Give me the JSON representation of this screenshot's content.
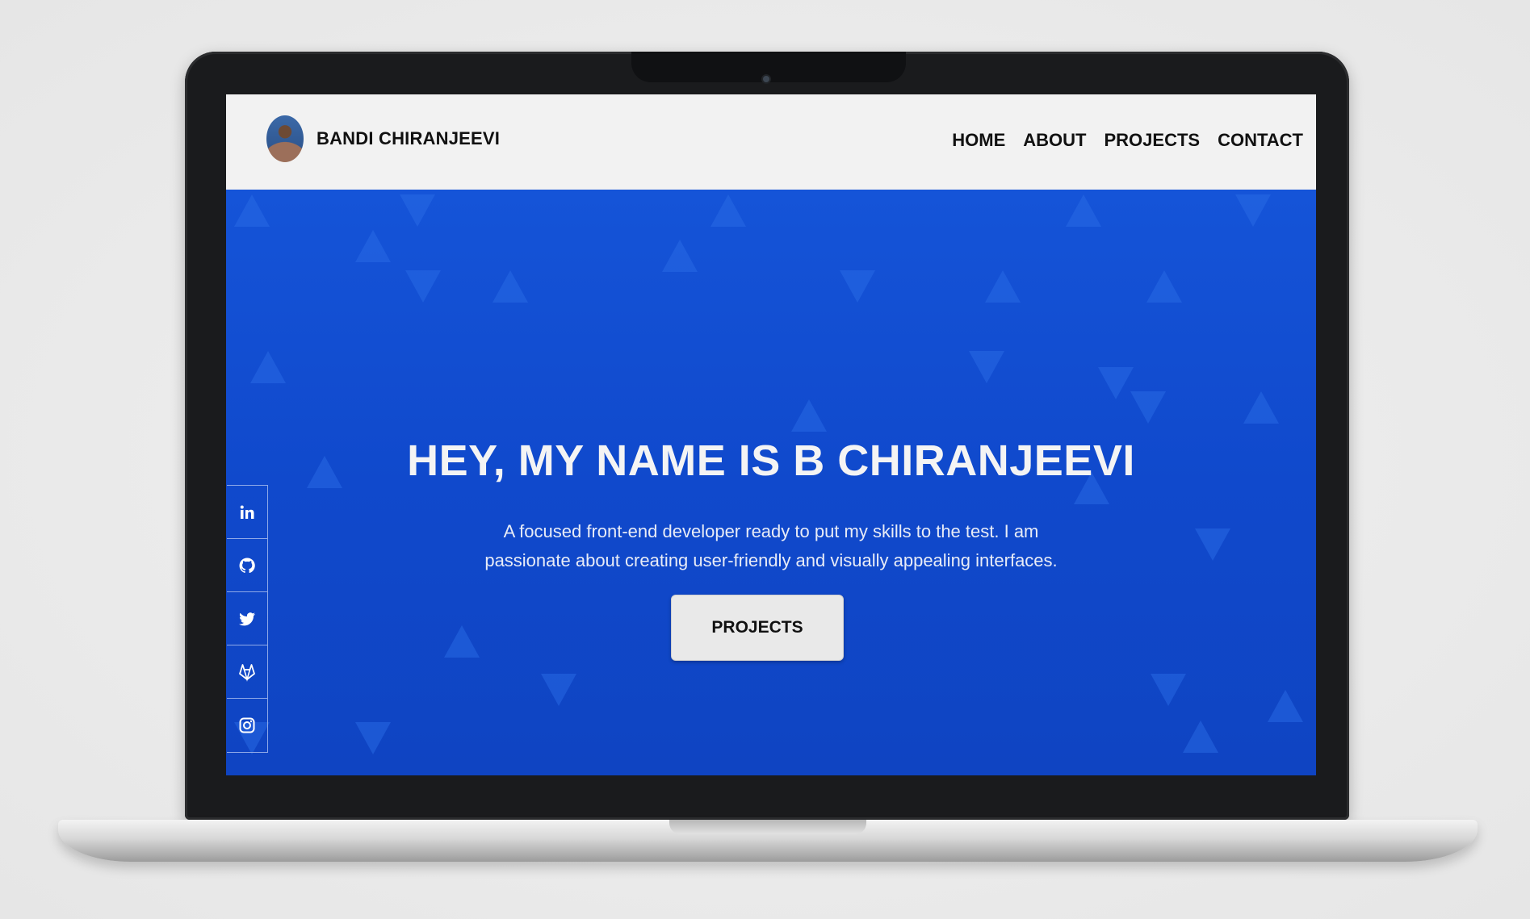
{
  "nav": {
    "brand_name": "BANDI CHIRANJEEVI",
    "links": [
      "HOME",
      "ABOUT",
      "PROJECTS",
      "CONTACT"
    ]
  },
  "hero": {
    "title": "HEY, MY NAME IS B CHIRANJEEVI",
    "subtitle": "A focused front-end developer ready to put my skills to the test. I am passionate about creating user-friendly and visually appealing interfaces.",
    "cta_label": "PROJECTS"
  },
  "social": [
    {
      "icon": "linkedin-icon"
    },
    {
      "icon": "github-icon"
    },
    {
      "icon": "twitter-icon"
    },
    {
      "icon": "gitlab-icon"
    },
    {
      "icon": "instagram-icon"
    }
  ],
  "colors": {
    "hero_bg": "#1049cc",
    "nav_bg": "#f2f2f2",
    "text_light": "#f4f4f4",
    "button_bg": "#e9e9e9"
  }
}
